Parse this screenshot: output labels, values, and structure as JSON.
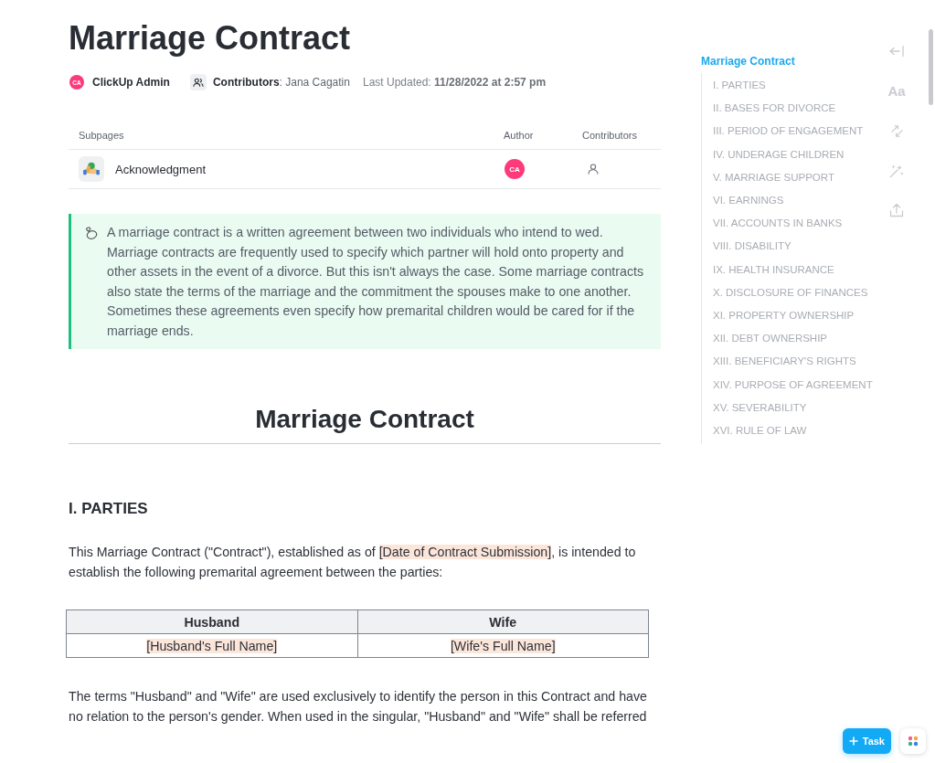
{
  "page": {
    "title": "Marriage Contract"
  },
  "meta": {
    "author": {
      "initials": "CA",
      "name": "ClickUp Admin"
    },
    "contributors": "**Contributors**: Jana Cagatin",
    "last_updated": "Last Updated: **11/28/2022 at 2:57 pm**"
  },
  "subpages": {
    "columns": [
      "Subpages",
      "Author",
      "Contributors"
    ],
    "rows": [
      {
        "title": "Acknowledgment",
        "author_initials": "CA"
      }
    ]
  },
  "callout": {
    "text": "A marriage contract is a written agreement between two individuals who intend to wed. Marriage contracts are frequently used to specify which partner will hold onto property and other assets in the event of a divorce. But this isn't always the case. Some marriage contracts also state the terms of the marriage and the commitment the spouses make to one another. Sometimes these agreements even specify how premarital children would be cared for if the marriage ends."
  },
  "document": {
    "heading": "Marriage Contract",
    "sections": [
      {
        "heading": "I. PARTIES",
        "blocks": [
          {
            "kind": "paragraph",
            "segments": [
              {
                "text": "This Marriage Contract (\"Contract\"), established as of ",
                "highlighted": false
              },
              {
                "text": "[Date of Contract Submission]",
                "highlighted": true
              },
              {
                "text": ", is intended to establish the following premarital agreement between the parties:",
                "highlighted": false
              }
            ]
          },
          {
            "kind": "table",
            "columns": [
              "Husband",
              "Wife"
            ],
            "rows": [
              [
                {
                  "text": "[Husband's Full Name]",
                  "highlighted": true
                },
                {
                  "text": "[Wife's Full Name]",
                  "highlighted": true
                }
              ]
            ]
          },
          {
            "kind": "paragraph",
            "segments": [
              {
                "text": "The terms \"Husband\" and \"Wife\" are used exclusively to identify the person in this Contract and have no relation to the person's gender. When used in the singular, \"Husband\" and \"Wife\" shall be referred",
                "highlighted": false
              }
            ]
          }
        ]
      }
    ]
  },
  "outline": {
    "items": [
      {
        "label": "Marriage Contract",
        "selected": true,
        "children": [
          {
            "label": "I. PARTIES",
            "selected": false
          },
          {
            "label": "II. BASES FOR DIVORCE",
            "selected": false
          },
          {
            "label": "III. PERIOD OF ENGAGEMENT",
            "selected": false
          },
          {
            "label": "IV. UNDERAGE CHILDREN",
            "selected": false
          },
          {
            "label": "V. MARRIAGE SUPPORT",
            "selected": false
          },
          {
            "label": "VI. EARNINGS",
            "selected": false
          },
          {
            "label": "VII. ACCOUNTS IN BANKS",
            "selected": false
          },
          {
            "label": "VIII. DISABILITY",
            "selected": false
          },
          {
            "label": "IX. HEALTH INSURANCE",
            "selected": false
          },
          {
            "label": "X. DISCLOSURE OF FINANCES",
            "selected": false
          },
          {
            "label": "XI. PROPERTY OWNERSHIP",
            "selected": false
          },
          {
            "label": "XII. DEBT OWNERSHIP",
            "selected": false
          },
          {
            "label": "XIII. BENEFICIARY'S RIGHTS",
            "selected": false
          },
          {
            "label": "XIV. PURPOSE OF AGREEMENT",
            "selected": false
          },
          {
            "label": "XV. SEVERABILITY",
            "selected": false
          },
          {
            "label": "XVI. RULE OF LAW",
            "selected": false
          }
        ]
      }
    ]
  },
  "toolbar": [
    {
      "kind": "collapse"
    },
    {
      "kind": "font",
      "label": "Aa"
    },
    {
      "kind": "swap"
    },
    {
      "kind": "sparkle"
    },
    {
      "kind": "upload"
    }
  ],
  "task_button": {
    "label": "Task"
  }
}
